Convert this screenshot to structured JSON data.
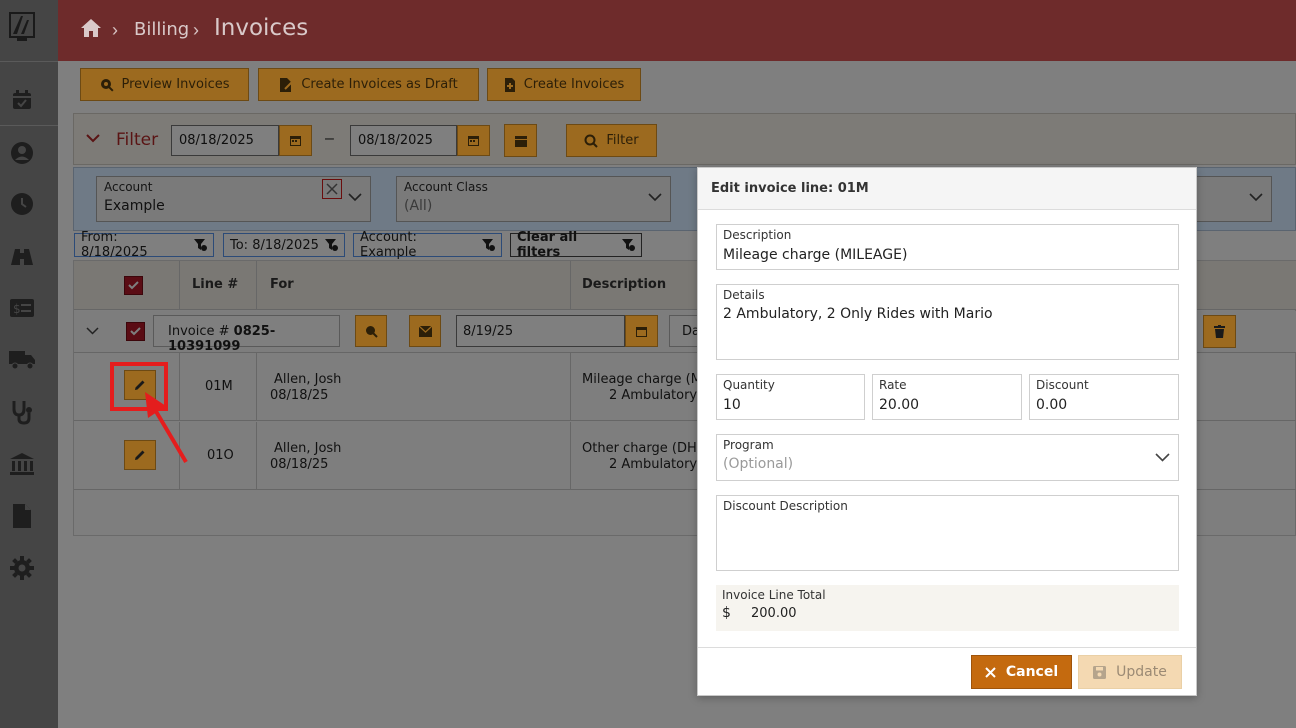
{
  "breadcrumb": {
    "home_icon": "home-icon",
    "billing": "Billing",
    "invoices": "Invoices"
  },
  "sidebar": {
    "icons": [
      "calendar-check-icon",
      "user-icon",
      "clock-icon",
      "binoculars-icon",
      "money-list-icon",
      "truck-icon",
      "stethoscope-icon",
      "bank-icon",
      "file-icon",
      "gear-icon"
    ]
  },
  "toolbar": {
    "preview": "Preview Invoices",
    "draft": "Create Invoices as Draft",
    "create": "Create Invoices"
  },
  "filter": {
    "label": "Filter",
    "from_date": "08/18/2025",
    "to_date": "08/18/2025",
    "dash": "–",
    "filter_button": "Filter"
  },
  "account": {
    "label": "Account",
    "value": "Example"
  },
  "account_class": {
    "label": "Account Class",
    "value": "(All)"
  },
  "chips": {
    "from": "From: 8/18/2025",
    "to": "To: 8/18/2025",
    "account": "Account: Example",
    "clear": "Clear all filters"
  },
  "table": {
    "headers": {
      "line": "Line #",
      "for": "For",
      "description": "Description"
    },
    "group": {
      "invoice_prefix": "Invoice #",
      "invoice_number": "0825-10391099",
      "date": "8/19/25",
      "partial": "Da"
    },
    "rows": [
      {
        "line": "01M",
        "name": "Allen, Josh",
        "date": "08/18/25",
        "desc1": "Mileage charge (M",
        "desc2": "2 Ambulatory,"
      },
      {
        "line": "01O",
        "name": "Allen, Josh",
        "date": "08/18/25",
        "desc1": "Other charge (DH",
        "desc2": "2 Ambulatory,"
      }
    ]
  },
  "modal": {
    "title": "Edit invoice line: 01M",
    "description": {
      "label": "Description",
      "value": "Mileage charge (MILEAGE)"
    },
    "details": {
      "label": "Details",
      "value": "2 Ambulatory, 2 Only Rides with Mario"
    },
    "quantity": {
      "label": "Quantity",
      "value": "10"
    },
    "rate": {
      "label": "Rate",
      "value": "20.00"
    },
    "discount": {
      "label": "Discount",
      "value": "0.00"
    },
    "program": {
      "label": "Program",
      "placeholder": "(Optional)"
    },
    "discount_description": {
      "label": "Discount Description",
      "value": ""
    },
    "total": {
      "label": "Invoice Line Total",
      "currency": "$",
      "value": "200.00"
    },
    "cancel": "Cancel",
    "update": "Update"
  },
  "colors": {
    "header": "#6e2b2b",
    "accent": "#c46a0f",
    "sidebar": "#454545",
    "highlight": "#e41d1d"
  }
}
